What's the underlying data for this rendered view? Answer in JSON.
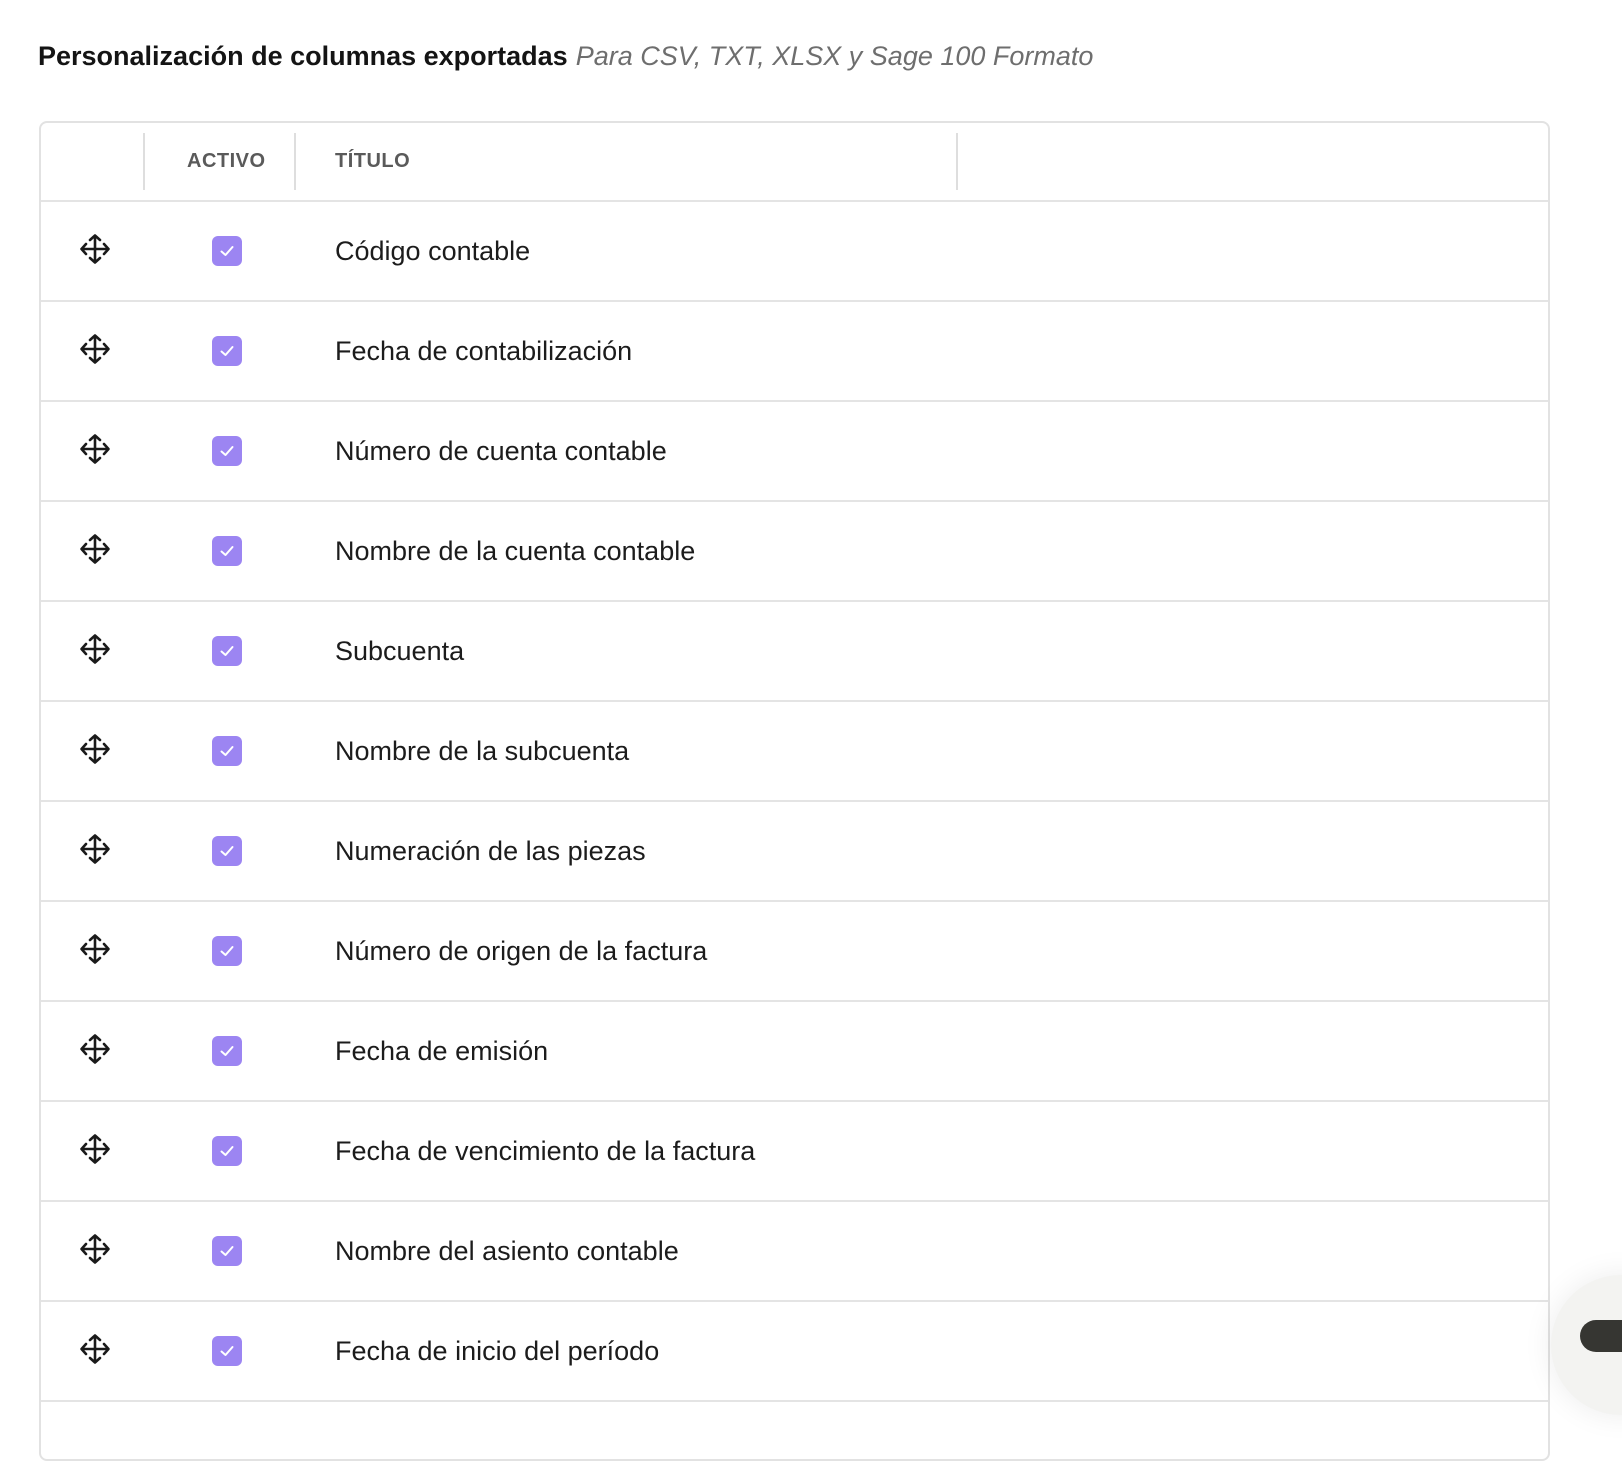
{
  "header": {
    "title": "Personalización de columnas exportadas",
    "subtitle": "Para CSV, TXT, XLSX y Sage 100 Formato"
  },
  "table": {
    "columns": {
      "active": "ACTIVO",
      "title": "TÍTULO"
    },
    "rows": [
      {
        "label": "Código contable",
        "active": true
      },
      {
        "label": "Fecha de contabilización",
        "active": true
      },
      {
        "label": "Número de cuenta contable",
        "active": true
      },
      {
        "label": "Nombre de la cuenta contable",
        "active": true
      },
      {
        "label": "Subcuenta",
        "active": true
      },
      {
        "label": "Nombre de la subcuenta",
        "active": true
      },
      {
        "label": "Numeración de las piezas",
        "active": true
      },
      {
        "label": "Número de origen de la factura",
        "active": true
      },
      {
        "label": "Fecha de emisión",
        "active": true
      },
      {
        "label": "Fecha de vencimiento de la factura",
        "active": true
      },
      {
        "label": "Nombre del asiento contable",
        "active": true
      },
      {
        "label": "Fecha de inicio del período",
        "active": true
      }
    ]
  },
  "colors": {
    "checkbox": "#9c85f2",
    "border": "#e4e4e4",
    "chat_widget": "#363632"
  },
  "icons": {
    "drag": "drag-move-icon",
    "check": "check-icon"
  }
}
